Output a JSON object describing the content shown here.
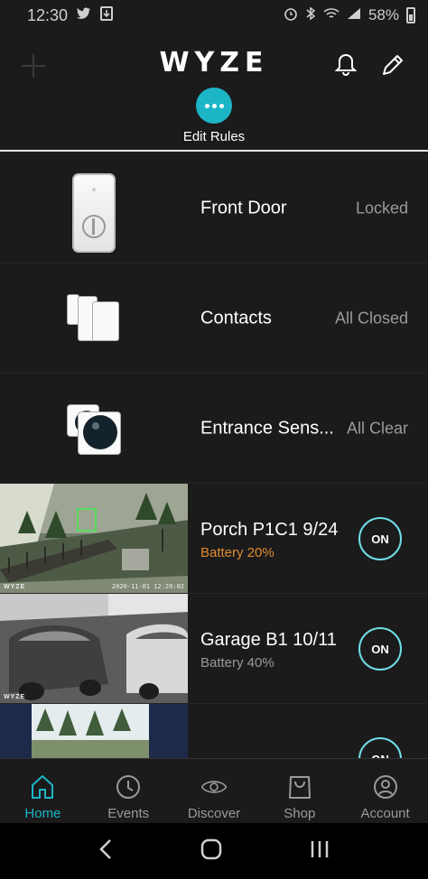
{
  "status_bar": {
    "time": "12:30",
    "left_icons": [
      "twitter-icon",
      "download-icon"
    ],
    "right_icons": [
      "alarm-icon",
      "bluetooth-icon",
      "wifi-icon",
      "signal-icon"
    ],
    "battery": "58%"
  },
  "header": {
    "logo": "WYZE",
    "edit_rules_label": "Edit Rules"
  },
  "devices": [
    {
      "name": "Front Door",
      "status": "Locked",
      "icon": "lock-icon"
    },
    {
      "name": "Contacts",
      "status": "All Closed",
      "icon": "contact-sensor-icon"
    },
    {
      "name": "Entrance Sens...",
      "status": "All Clear",
      "icon": "motion-sensor-icon"
    }
  ],
  "cameras": [
    {
      "name": "Porch P1C1 9/24",
      "battery": "Battery 20%",
      "toggle": "ON",
      "timestamp": "2020-11-01 12:20:02",
      "brand": "WYZE",
      "battery_color": "#e08a2e"
    },
    {
      "name": "Garage B1 10/11",
      "battery": "Battery 40%",
      "toggle": "ON",
      "timestamp": "",
      "brand": "WYZE",
      "battery_color": "#9a9a9a"
    },
    {
      "name": "",
      "battery": "",
      "toggle": "ON"
    }
  ],
  "tabs": [
    {
      "label": "Home",
      "icon": "home-icon",
      "active": true
    },
    {
      "label": "Events",
      "icon": "clock-icon",
      "active": false
    },
    {
      "label": "Discover",
      "icon": "eye-icon",
      "active": false
    },
    {
      "label": "Shop",
      "icon": "shopping-bag-icon",
      "active": false
    },
    {
      "label": "Account",
      "icon": "account-icon",
      "active": false
    }
  ],
  "colors": {
    "accent": "#1cb5c6",
    "background": "#1b1b1b",
    "toggle_ring": "#6fdde6",
    "battery_low": "#e08a2e"
  }
}
